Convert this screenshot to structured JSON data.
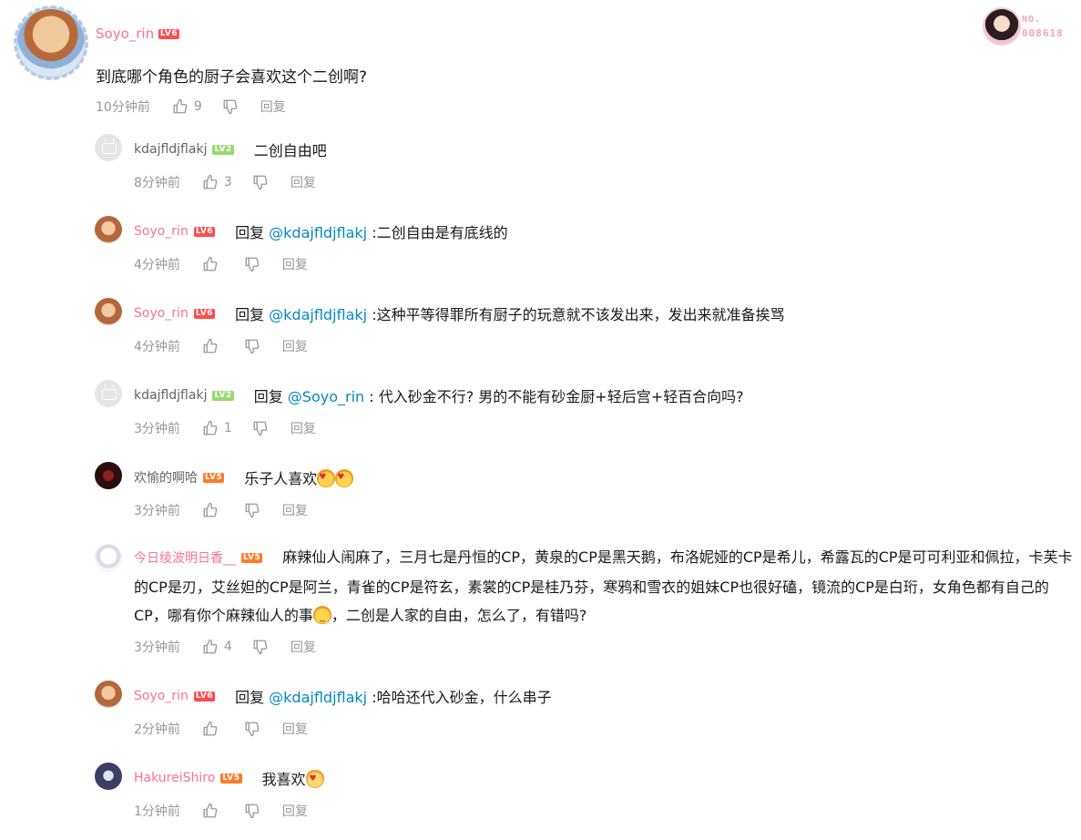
{
  "main_comment": {
    "username": "Soyo_rin",
    "level": "LV6",
    "text": "到底哪个角色的厨子会喜欢这个二创啊?",
    "time": "10分钟前",
    "likes": "9",
    "reply_label": "回复"
  },
  "badge": {
    "no_label": "NO.",
    "no_value": "008618"
  },
  "replies": [
    {
      "username": "kdajfldjflakj",
      "level": "LV2",
      "prefix": "",
      "mention": "",
      "text": "二创自由吧",
      "time": "8分钟前",
      "likes": "3",
      "reply_label": "回复"
    },
    {
      "username": "Soyo_rin",
      "level": "LV6",
      "prefix": "回复 ",
      "mention": "@kdajfldjflakj",
      "text": " :二创自由是有底线的",
      "time": "4分钟前",
      "likes": "",
      "reply_label": "回复"
    },
    {
      "username": "Soyo_rin",
      "level": "LV6",
      "prefix": "回复 ",
      "mention": "@kdajfldjflakj",
      "text": " :这种平等得罪所有厨子的玩意就不该发出来，发出来就准备挨骂",
      "time": "4分钟前",
      "likes": "",
      "reply_label": "回复"
    },
    {
      "username": "kdajfldjflakj",
      "level": "LV2",
      "prefix": "回复 ",
      "mention": "@Soyo_rin",
      "text": " : 代入砂金不行? 男的不能有砂金厨+轻后宫+轻百合向吗?",
      "time": "3分钟前",
      "likes": "1",
      "reply_label": "回复"
    },
    {
      "username": "欢愉的啊哈",
      "level": "LV5",
      "prefix": "",
      "mention": "",
      "text": "乐子人喜欢",
      "time": "3分钟前",
      "likes": "",
      "reply_label": "回复"
    },
    {
      "username": "今日绫波明日香__",
      "level": "LV5",
      "prefix": "",
      "mention": "",
      "text": "麻辣仙人闹麻了，三月七是丹恒的CP，黄泉的CP是黑天鹅，布洛妮娅的CP是希儿，希露瓦的CP是可可利亚和佩拉，卡芙卡的CP是刃，艾丝妲的CP是阿兰，青雀的CP是符玄，素裳的CP是桂乃芬，寒鸦和雪衣的姐妹CP也很好磕，镜流的CP是白珩，女角色都有自己的CP，哪有你个麻辣仙人的事",
      "text2": "，二创是人家的自由，怎么了，有错吗?",
      "time": "3分钟前",
      "likes": "4",
      "reply_label": "回复"
    },
    {
      "username": "Soyo_rin",
      "level": "LV6",
      "prefix": "回复 ",
      "mention": "@kdajfldjflakj",
      "text": " :哈哈还代入砂金，什么串子",
      "time": "2分钟前",
      "likes": "",
      "reply_label": "回复"
    },
    {
      "username": "HakureiShiro",
      "level": "LV5",
      "prefix": "",
      "mention": "",
      "text": "我喜欢",
      "time": "1分钟前",
      "likes": "",
      "reply_label": "回复"
    }
  ],
  "icons": {
    "like": "thumbs-up-icon",
    "dislike": "thumbs-down-icon",
    "default_avatar": "tv-icon"
  },
  "colors": {
    "username_vip": "#fb7299",
    "mention": "#008ac5",
    "meta": "#9499a0",
    "lv6": "#ff4d4f",
    "lv5": "#ff7a29",
    "lv2": "#95d96f"
  }
}
